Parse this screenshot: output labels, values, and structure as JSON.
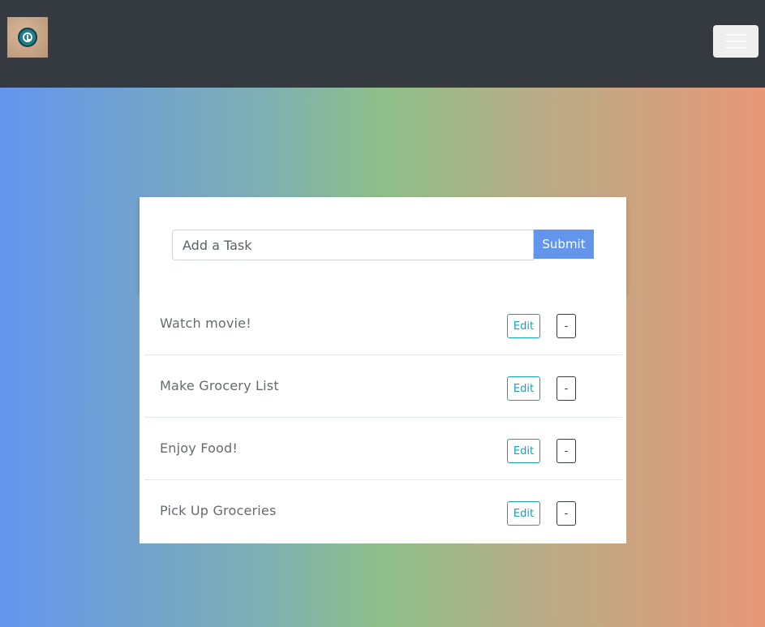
{
  "navbar": {
    "logo_icon": "clock-app-logo",
    "menu_icon": "hamburger-icon"
  },
  "form": {
    "input_placeholder": "Add a Task",
    "input_value": "",
    "submit_label": "Submit"
  },
  "tasks": [
    {
      "label": "Watch movie!",
      "edit_label": "Edit",
      "delete_label": "-"
    },
    {
      "label": "Make Grocery List",
      "edit_label": "Edit",
      "delete_label": "-"
    },
    {
      "label": "Enjoy Food!",
      "edit_label": "Edit",
      "delete_label": "-"
    },
    {
      "label": "Pick Up Groceries",
      "edit_label": "Edit",
      "delete_label": "-"
    }
  ],
  "colors": {
    "navbar": "#343a40",
    "submit": "#6495ed",
    "edit": "#17a2b8",
    "gradient": [
      "#6495ed",
      "#8fbf8a",
      "#e89878"
    ]
  }
}
